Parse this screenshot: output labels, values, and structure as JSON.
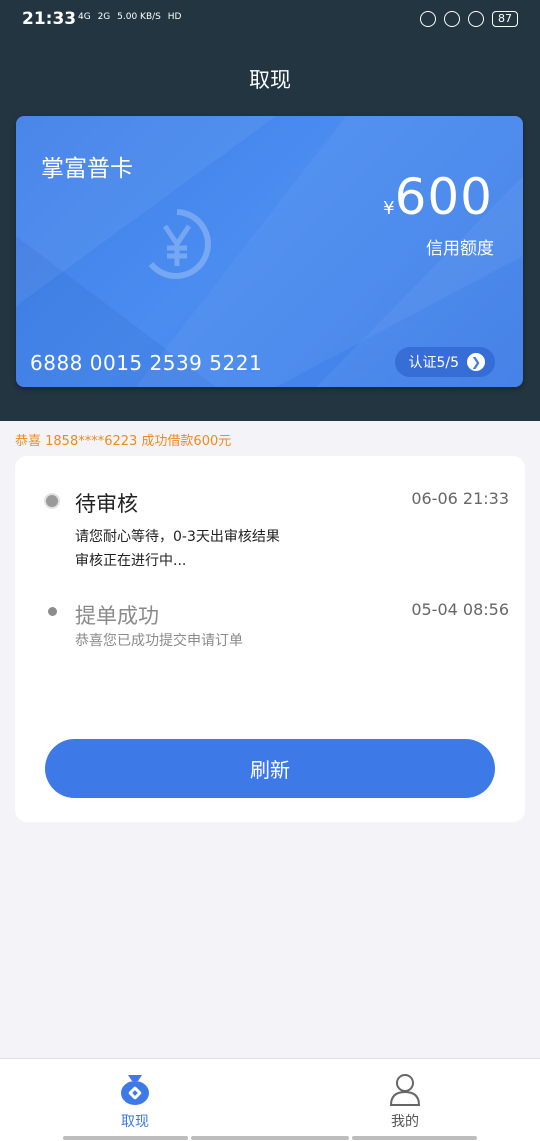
{
  "status_bar": {
    "time": "21:33",
    "net_4g": "4G",
    "net_2g": "2G",
    "speed": "5.00 KB/S",
    "hd": "HD",
    "battery": "87"
  },
  "header": {
    "title": "取现"
  },
  "card": {
    "name": "掌富普卡",
    "currency_symbol": "¥",
    "amount": "600",
    "amount_label": "信用额度",
    "number": "6888 0015 2539 5221",
    "verify_label": "认证5/5"
  },
  "notice": {
    "text": "恭喜 1858****6223 成功借款600元"
  },
  "steps": [
    {
      "title": "待审核",
      "time": "06-06  21:33",
      "desc1": "请您耐心等待，0-3天出审核结果",
      "desc2": "审核正在进行中..."
    },
    {
      "title": "提单成功",
      "time": "05-04 08:56",
      "desc": "恭喜您已成功提交申请订单"
    }
  ],
  "refresh_label": "刷新",
  "tabs": [
    {
      "label": "取现",
      "icon": "money-bag-icon",
      "active": true
    },
    {
      "label": "我的",
      "icon": "user-icon",
      "active": false
    }
  ],
  "colors": {
    "primary": "#3d7ae8",
    "header_bg": "#233540",
    "notice": "#f08a1c"
  }
}
